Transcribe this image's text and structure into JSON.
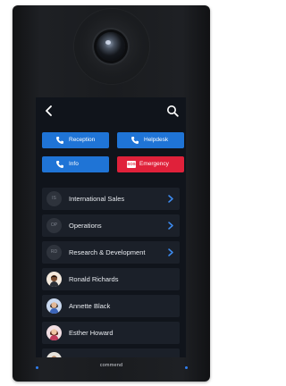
{
  "quick_actions": [
    {
      "label": "Reception",
      "icon": "phone-icon"
    },
    {
      "label": "Helpdesk",
      "icon": "phone-icon"
    },
    {
      "label": "Info",
      "icon": "phone-icon"
    },
    {
      "label": "Emergency",
      "icon": "sos-icon",
      "badge": "SOS"
    }
  ],
  "contacts": [
    {
      "label": "International Sales",
      "badge": "IS",
      "type": "group"
    },
    {
      "label": "Operations",
      "badge": "OP",
      "type": "group"
    },
    {
      "label": "Research & Development",
      "badge": "RD",
      "type": "group"
    },
    {
      "label": "Ronald Richards",
      "type": "person"
    },
    {
      "label": "Annette Black",
      "type": "person"
    },
    {
      "label": "Esther Howard",
      "type": "person"
    }
  ],
  "brand": "commend",
  "colors": {
    "accent": "#1f74d6",
    "emergency": "#e0213a",
    "screen_bg": "#10141b",
    "row_bg": "#1b2029",
    "led": "#2f7ef0"
  }
}
